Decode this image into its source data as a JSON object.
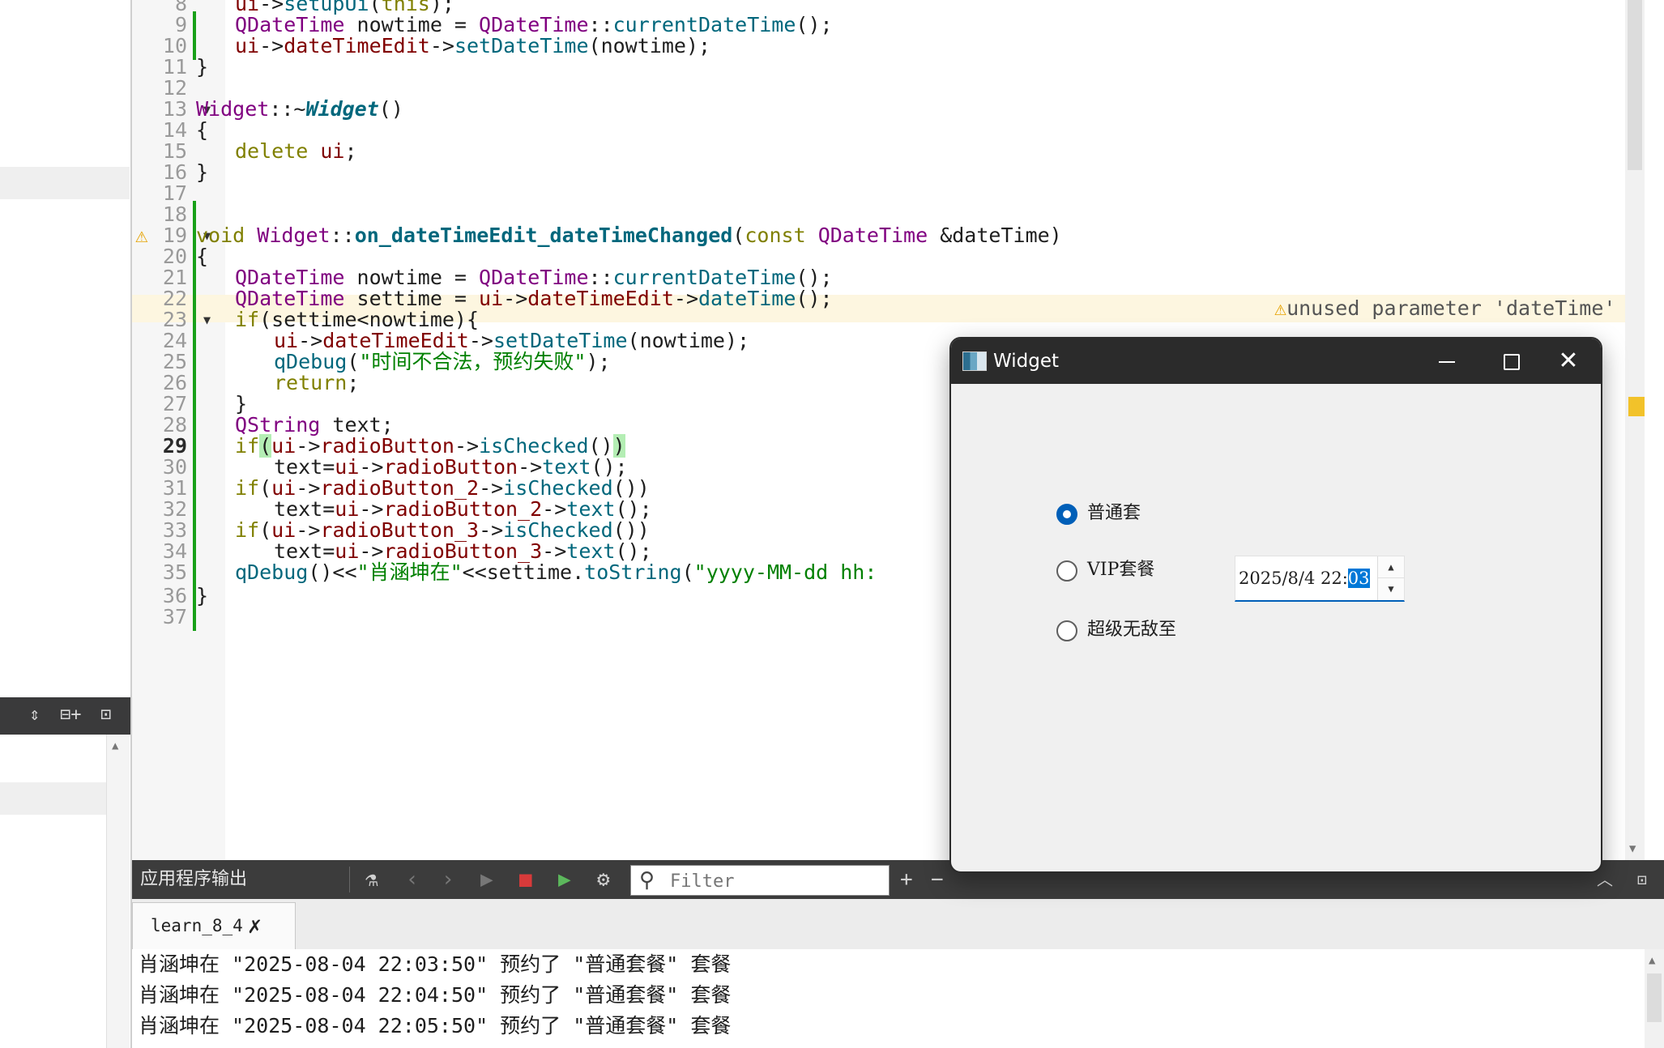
{
  "editor": {
    "lines": [
      {
        "n": "8",
        "segs": [
          [
            "ui",
            "mb"
          ],
          [
            "->",
            ""
          ],
          [
            "setupUi",
            "fn"
          ],
          [
            "(",
            ""
          ],
          [
            "this",
            "kw"
          ],
          [
            ");",
            ""
          ]
        ]
      },
      {
        "n": "9",
        "segs": [
          [
            "QDateTime",
            "ty"
          ],
          [
            " nowtime = ",
            ""
          ],
          [
            "QDateTime",
            "ty"
          ],
          [
            "::",
            ""
          ],
          [
            "currentDateTime",
            "fn"
          ],
          [
            "();",
            ""
          ]
        ]
      },
      {
        "n": "10",
        "segs": [
          [
            "ui",
            "mb"
          ],
          [
            "->",
            ""
          ],
          [
            "dateTimeEdit",
            "mb"
          ],
          [
            "->",
            ""
          ],
          [
            "setDateTime",
            "fn"
          ],
          [
            "(nowtime);",
            ""
          ]
        ]
      },
      {
        "n": "11",
        "segs": [
          [
            "}",
            ""
          ]
        ]
      },
      {
        "n": "12",
        "segs": []
      },
      {
        "n": "13",
        "segs": [
          [
            "Widget",
            "ty"
          ],
          [
            "::~",
            ""
          ],
          [
            "Widget",
            "fni"
          ],
          [
            "()",
            ""
          ]
        ]
      },
      {
        "n": "14",
        "segs": [
          [
            "{",
            ""
          ]
        ]
      },
      {
        "n": "15",
        "segs": [
          [
            "delete",
            "kw"
          ],
          [
            " ",
            ""
          ],
          [
            "ui",
            "mb"
          ],
          [
            ";",
            ""
          ]
        ]
      },
      {
        "n": "16",
        "segs": [
          [
            "}",
            ""
          ]
        ]
      },
      {
        "n": "17",
        "segs": []
      },
      {
        "n": "18",
        "segs": []
      },
      {
        "n": "19",
        "segs": [
          [
            "void",
            "kw"
          ],
          [
            " ",
            ""
          ],
          [
            "Widget",
            "ty"
          ],
          [
            "::",
            ""
          ],
          [
            "on_dateTimeEdit_dateTimeChanged",
            "fnb"
          ],
          [
            "(",
            ""
          ],
          [
            "const",
            "kw"
          ],
          [
            " ",
            ""
          ],
          [
            "QDateTime",
            "ty"
          ],
          [
            " &dateTime)",
            ""
          ]
        ]
      },
      {
        "n": "20",
        "segs": [
          [
            "{",
            ""
          ]
        ]
      },
      {
        "n": "21",
        "segs": [
          [
            "QDateTime",
            "ty"
          ],
          [
            " nowtime = ",
            ""
          ],
          [
            "QDateTime",
            "ty"
          ],
          [
            "::",
            ""
          ],
          [
            "currentDateTime",
            "fn"
          ],
          [
            "();",
            ""
          ]
        ]
      },
      {
        "n": "22",
        "segs": [
          [
            "QDateTime",
            "ty"
          ],
          [
            " settime = ",
            ""
          ],
          [
            "ui",
            "mb"
          ],
          [
            "->",
            ""
          ],
          [
            "dateTimeEdit",
            "mb"
          ],
          [
            "->",
            ""
          ],
          [
            "dateTime",
            "fn"
          ],
          [
            "();",
            ""
          ]
        ]
      },
      {
        "n": "23",
        "segs": [
          [
            "if",
            "kw"
          ],
          [
            "(settime<nowtime){",
            ""
          ]
        ]
      },
      {
        "n": "24",
        "segs": [
          [
            "ui",
            "mb"
          ],
          [
            "->",
            ""
          ],
          [
            "dateTimeEdit",
            "mb"
          ],
          [
            "->",
            ""
          ],
          [
            "setDateTime",
            "fn"
          ],
          [
            "(nowtime);",
            ""
          ]
        ]
      },
      {
        "n": "25",
        "segs": [
          [
            "qDebug",
            "fn"
          ],
          [
            "(",
            ""
          ],
          [
            "\"时间不合法，预约失败\"",
            "st"
          ],
          [
            ");",
            ""
          ]
        ]
      },
      {
        "n": "26",
        "segs": [
          [
            "return",
            "kw"
          ],
          [
            ";",
            ""
          ]
        ]
      },
      {
        "n": "27",
        "segs": [
          [
            "}",
            ""
          ]
        ]
      },
      {
        "n": "28",
        "segs": [
          [
            "QString",
            "ty"
          ],
          [
            " text;",
            ""
          ]
        ]
      },
      {
        "n": "29",
        "segs": [
          [
            "if",
            "kw"
          ],
          [
            "(",
            "hl"
          ],
          [
            "ui",
            "mb"
          ],
          [
            "->",
            ""
          ],
          [
            "radioButton",
            "mb"
          ],
          [
            "->",
            ""
          ],
          [
            "isChecked",
            "fn"
          ],
          [
            "()",
            ""
          ],
          [
            ")",
            "hl"
          ]
        ]
      },
      {
        "n": "30",
        "segs": [
          [
            "text=",
            ""
          ],
          [
            "ui",
            "mb"
          ],
          [
            "->",
            ""
          ],
          [
            "radioButton",
            "mb"
          ],
          [
            "->",
            ""
          ],
          [
            "text",
            "fn"
          ],
          [
            "();",
            ""
          ]
        ]
      },
      {
        "n": "31",
        "segs": [
          [
            "if",
            "kw"
          ],
          [
            "(",
            ""
          ],
          [
            "ui",
            "mb"
          ],
          [
            "->",
            ""
          ],
          [
            "radioButton_2",
            "mb"
          ],
          [
            "->",
            ""
          ],
          [
            "isChecked",
            "fn"
          ],
          [
            "())",
            ""
          ]
        ]
      },
      {
        "n": "32",
        "segs": [
          [
            "text=",
            ""
          ],
          [
            "ui",
            "mb"
          ],
          [
            "->",
            ""
          ],
          [
            "radioButton_2",
            "mb"
          ],
          [
            "->",
            ""
          ],
          [
            "text",
            "fn"
          ],
          [
            "();",
            ""
          ]
        ]
      },
      {
        "n": "33",
        "segs": [
          [
            "if",
            "kw"
          ],
          [
            "(",
            ""
          ],
          [
            "ui",
            "mb"
          ],
          [
            "->",
            ""
          ],
          [
            "radioButton_3",
            "mb"
          ],
          [
            "->",
            ""
          ],
          [
            "isChecked",
            "fn"
          ],
          [
            "())",
            ""
          ]
        ]
      },
      {
        "n": "34",
        "segs": [
          [
            "text=",
            ""
          ],
          [
            "ui",
            "mb"
          ],
          [
            "->",
            ""
          ],
          [
            "radioButton_3",
            "mb"
          ],
          [
            "->",
            ""
          ],
          [
            "text",
            "fn"
          ],
          [
            "();",
            ""
          ]
        ]
      },
      {
        "n": "35",
        "segs": [
          [
            "qDebug",
            "fn"
          ],
          [
            "()<<",
            ""
          ],
          [
            "\"肖涵坤在\"",
            "st"
          ],
          [
            "<<settime.",
            ""
          ],
          [
            "toString",
            "fn"
          ],
          [
            "(",
            ""
          ],
          [
            "\"yyyy-MM-dd hh:",
            "st"
          ]
        ]
      },
      {
        "n": "36",
        "segs": [
          [
            "}",
            ""
          ]
        ]
      },
      {
        "n": "37",
        "segs": []
      }
    ],
    "warning_text": "unused parameter 'dateTime'"
  },
  "output_pane": {
    "title": "应用程序输出",
    "filter_placeholder": "Filter",
    "tab_label": "learn_8_4",
    "lines": [
      "肖涵坤在 \"2025-08-04 22:03:50\" 预约了 \"普通套餐\" 套餐",
      "肖涵坤在 \"2025-08-04 22:04:50\" 预约了 \"普通套餐\" 套餐",
      "肖涵坤在 \"2025-08-04 22:05:50\" 预约了 \"普通套餐\" 套餐"
    ]
  },
  "widget_window": {
    "title": "Widget",
    "radios": [
      {
        "label": "普通套",
        "checked": true
      },
      {
        "label": "VIP套餐",
        "checked": false
      },
      {
        "label": "超级无敌至",
        "checked": false
      }
    ],
    "datetime_value": "2025/8/4 22:",
    "datetime_selected": "03"
  },
  "colors": {
    "keyword": "#808000",
    "type": "#800080",
    "function": "#00677c",
    "member": "#800000",
    "string": "#008000",
    "accent": "#005fb8",
    "warning": "#e6a200"
  }
}
